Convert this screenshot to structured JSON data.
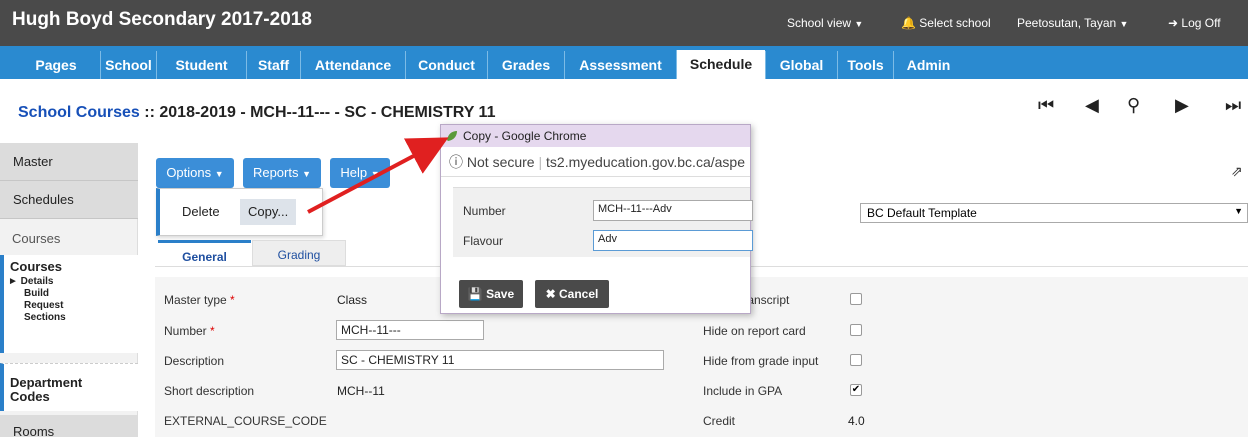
{
  "header": {
    "app_title": "Hugh Boyd Secondary 2017-2018",
    "school_view": "School view",
    "select_school": "Select school",
    "user": "Peetosutan, Tayan",
    "logoff": "Log Off"
  },
  "nav": {
    "tabs": [
      "Pages",
      "School",
      "Student",
      "Staff",
      "Attendance",
      "Conduct",
      "Grades",
      "Assessment",
      "Schedule",
      "Global",
      "Tools",
      "Admin"
    ],
    "active": "Schedule"
  },
  "page": {
    "title_link": "School Courses",
    "title_rest": ":: 2018-2019 - MCH--11--- - SC - CHEMISTRY 11"
  },
  "sidebar": {
    "master": "Master",
    "schedules": "Schedules",
    "courses_label": "Courses",
    "courses_group": "Courses",
    "subitems": [
      "► Details",
      "Build",
      "Request",
      "Sections"
    ],
    "department": "Department Codes",
    "rooms": "Rooms"
  },
  "toolbar": {
    "options": "Options",
    "reports": "Reports",
    "help": "Help"
  },
  "options_menu": {
    "delete": "Delete",
    "copy": "Copy..."
  },
  "subtabs": {
    "general": "General",
    "grading": "Grading"
  },
  "template_select": "BC Default Template",
  "form": {
    "master_type_label": "Master type",
    "master_type_value": "Class",
    "number_label": "Number",
    "number_value": "MCH--11---",
    "description_label": "Description",
    "description_value": "SC - CHEMISTRY 11",
    "short_desc_label": "Short description",
    "short_desc_value": "MCH--11",
    "external_label": "EXTERNAL_COURSE_CODE",
    "hide_transcript_label": "transcript",
    "hide_report_label": "Hide on report card",
    "hide_grade_label": "Hide from grade input",
    "include_gpa_label": "Include in GPA",
    "credit_label": "Credit",
    "credit_value": "4.0"
  },
  "popup": {
    "window_title": "Copy - Google Chrome",
    "not_secure": "Not secure",
    "url": "ts2.myeducation.gov.bc.ca/aspe",
    "number_label": "Number",
    "number_value": "MCH--11---Adv",
    "flavour_label": "Flavour",
    "flavour_value": "Adv",
    "save": "Save",
    "cancel": "Cancel"
  },
  "colors": {
    "header_bg": "#4a4a4a",
    "nav_bg": "#2a8ad0",
    "button_bg": "#3b8ed8",
    "link": "#1750b8",
    "arrow": "#e02020"
  }
}
